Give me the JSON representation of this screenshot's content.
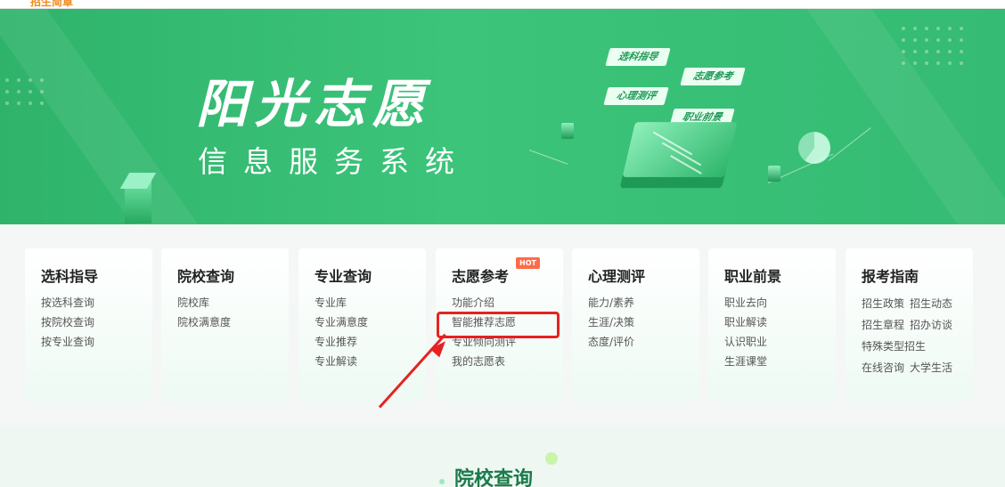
{
  "header": {
    "top_link": "招生简章"
  },
  "banner": {
    "title": "阳光志愿",
    "subtitle": "信息服务系统",
    "tags": [
      "选科指导",
      "志愿参考",
      "心理测评",
      "职业前景"
    ]
  },
  "cards": [
    {
      "title": "选科指导",
      "items": [
        "按选科查询",
        "按院校查询",
        "按专业查询"
      ]
    },
    {
      "title": "院校查询",
      "items": [
        "院校库",
        "院校满意度"
      ]
    },
    {
      "title": "专业查询",
      "items": [
        "专业库",
        "专业满意度",
        "专业推荐",
        "专业解读"
      ]
    },
    {
      "title": "志愿参考",
      "badge": "HOT",
      "items": [
        "功能介绍",
        "智能推荐志愿",
        "专业倾向测评",
        "我的志愿表"
      ]
    },
    {
      "title": "心理测评",
      "items": [
        "能力/素养",
        "生涯/决策",
        "态度/评价"
      ]
    },
    {
      "title": "职业前景",
      "items": [
        "职业去向",
        "职业解读",
        "认识职业",
        "生涯课堂"
      ]
    },
    {
      "title": "报考指南",
      "items": [
        "招生政策",
        "招生动态",
        "招生章程",
        "招办访谈",
        "特殊类型招生",
        "在线咨询",
        "大学生活"
      ]
    }
  ],
  "section": {
    "title": "院校查询"
  },
  "colors": {
    "brand_green": "#3cc47a",
    "highlight_red": "#e62222",
    "hot_badge": "#ff6b47"
  }
}
